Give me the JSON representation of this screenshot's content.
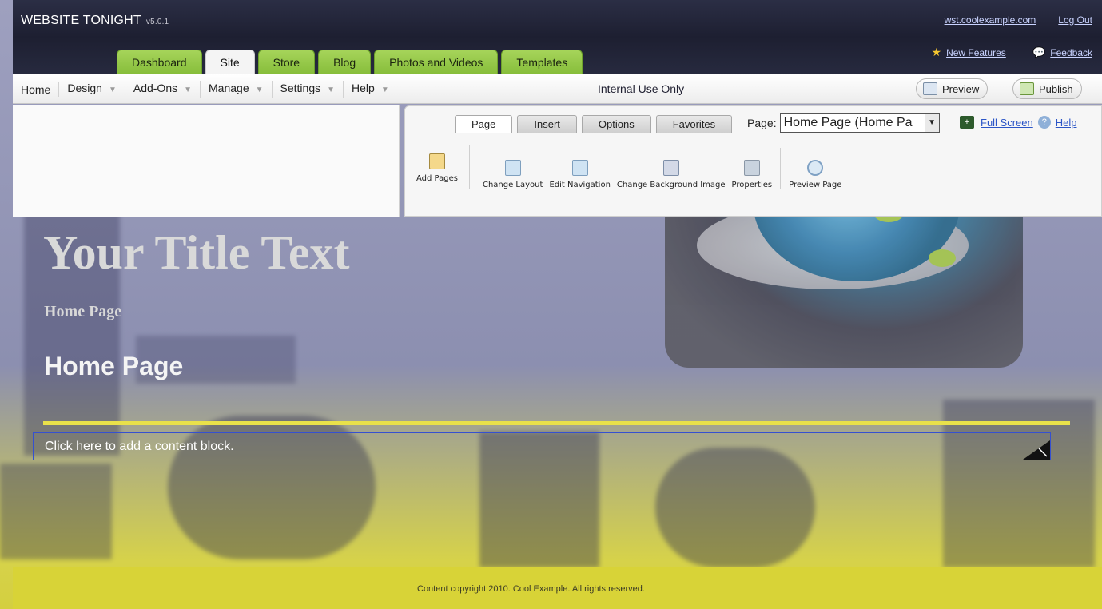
{
  "header": {
    "brand": "WEBSITE TONIGHT",
    "version": "v5.0.1",
    "domain_link": "wst.coolexample.com",
    "logout_link": "Log Out",
    "new_features": "New Features",
    "feedback": "Feedback"
  },
  "tabs": [
    {
      "label": "Dashboard"
    },
    {
      "label": "Site"
    },
    {
      "label": "Store"
    },
    {
      "label": "Blog"
    },
    {
      "label": "Photos and Videos"
    },
    {
      "label": "Templates"
    }
  ],
  "menu": [
    {
      "label": "Home"
    },
    {
      "label": "Design"
    },
    {
      "label": "Add-Ons"
    },
    {
      "label": "Manage"
    },
    {
      "label": "Settings"
    },
    {
      "label": "Help"
    }
  ],
  "internal_use": "Internal Use Only",
  "buttons": {
    "preview": "Preview",
    "publish": "Publish"
  },
  "ribbon": {
    "tabs": [
      {
        "label": "Page"
      },
      {
        "label": "Insert"
      },
      {
        "label": "Options"
      },
      {
        "label": "Favorites"
      }
    ],
    "page_label": "Page:",
    "page_value": "Home Page (Home Pa",
    "full_screen": "Full Screen",
    "help": "Help",
    "tools": [
      {
        "label": "Add Pages"
      },
      {
        "label": "Change Layout"
      },
      {
        "label": "Edit Navigation"
      },
      {
        "label": "Change Background Image"
      },
      {
        "label": "Properties"
      },
      {
        "label": "Preview Page"
      }
    ]
  },
  "site": {
    "title": "Your Title Text",
    "subtitle": "Home Page",
    "heading": "Home Page",
    "content_prompt": "Click here to add a content block.",
    "footer": "Content copyright 2010. Cool Example. All rights reserved."
  }
}
